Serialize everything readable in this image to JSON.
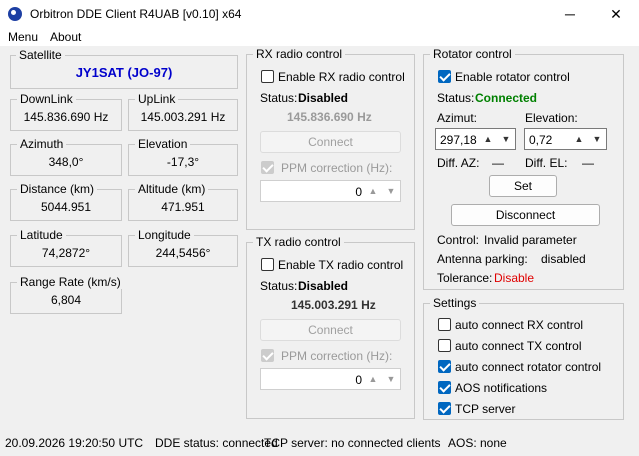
{
  "window": {
    "title": "Orbitron DDE Client R4UAB [v0.10] x64",
    "minimize": "─",
    "maximize": "☐",
    "close": "✕"
  },
  "menu": {
    "items": [
      "Menu",
      "About"
    ]
  },
  "satellite": {
    "label": "Satellite",
    "name": "JY1SAT (JO-97)"
  },
  "fields": {
    "downlink": {
      "label": "DownLink",
      "value": "145.836.690 Hz"
    },
    "uplink": {
      "label": "UpLink",
      "value": "145.003.291 Hz"
    },
    "azimuth": {
      "label": "Azimuth",
      "value": "348,0°"
    },
    "elevation": {
      "label": "Elevation",
      "value": "-17,3°"
    },
    "distance": {
      "label": "Distance (km)",
      "value": "5044.951"
    },
    "altitude": {
      "label": "Altitude (km)",
      "value": "471.951"
    },
    "latitude": {
      "label": "Latitude",
      "value": "74,2872°"
    },
    "longitude": {
      "label": "Longitude",
      "value": "244,5456°"
    },
    "range_rate": {
      "label": "Range Rate (km/s)",
      "value": "6,804"
    }
  },
  "rx": {
    "title": "RX radio control",
    "enable_label": "Enable RX radio control",
    "status_label": "Status:",
    "status_value": "Disabled",
    "frequency": "145.836.690 Hz",
    "connect_label": "Connect",
    "ppm_label": "PPM correction (Hz):",
    "ppm_value": "0"
  },
  "tx": {
    "title": "TX radio control",
    "enable_label": "Enable TX radio control",
    "status_label": "Status:",
    "status_value": "Disabled",
    "frequency": "145.003.291 Hz",
    "connect_label": "Connect",
    "ppm_label": "PPM correction (Hz):",
    "ppm_value": "0"
  },
  "rotator": {
    "title": "Rotator control",
    "enable_label": "Enable rotator control",
    "status_label": "Status:",
    "status_value": "Connected",
    "azimut_label": "Azimut:",
    "azimut_value": "297,18",
    "elevation_label": "Elevation:",
    "elevation_value": "0,72",
    "diff_az_label": "Diff. AZ:",
    "diff_az_value": "—",
    "diff_el_label": "Diff. EL:",
    "diff_el_value": "—",
    "set_label": "Set",
    "disconnect_label": "Disconnect",
    "control_label": "Control:",
    "control_value": "Invalid parameter",
    "parking_label": "Antenna parking:",
    "parking_value": "disabled",
    "tolerance_label": "Tolerance:",
    "tolerance_value": "Disable"
  },
  "settings": {
    "title": "Settings",
    "items": [
      {
        "label": "auto connect RX control",
        "checked": false
      },
      {
        "label": "auto connect TX control",
        "checked": false
      },
      {
        "label": "auto connect rotator control",
        "checked": true
      },
      {
        "label": "AOS notifications",
        "checked": true
      },
      {
        "label": "TCP server",
        "checked": true
      }
    ]
  },
  "statusbar": {
    "datetime": "20.09.2026 19:20:50 UTC",
    "dde": "DDE status: connected",
    "tcp": "TCP server: no connected clients",
    "aos": "AOS: none"
  },
  "colors": {
    "satellite_name": "#0000cc",
    "connected": "#008000",
    "tolerance": "#e00000",
    "checkbox_checked": "#0067c0"
  }
}
